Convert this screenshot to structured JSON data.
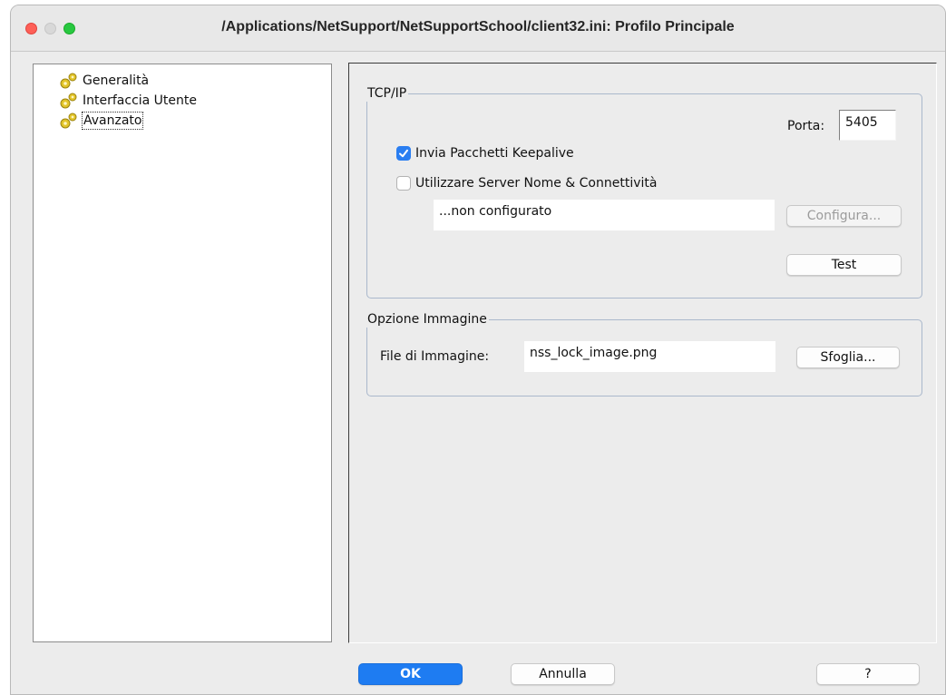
{
  "window": {
    "title": "/Applications/NetSupport/NetSupportSchool/client32.ini: Profilo Principale"
  },
  "tree": {
    "items": [
      {
        "label": "Generalità",
        "icon": "gear-icon"
      },
      {
        "label": "Interfaccia Utente",
        "icon": "gear-icon"
      },
      {
        "label": "Avanzato",
        "icon": "gear-icon",
        "selected": true
      }
    ]
  },
  "tcpip": {
    "legend": "TCP/IP",
    "porta_label": "Porta:",
    "porta_value": "5405",
    "keepalive_label": "Invia Pacchetti Keepalive",
    "keepalive_checked": true,
    "server_label": "Utilizzare Server Nome & Connettività",
    "server_checked": false,
    "server_status": "...non configurato",
    "configura_button": "Configura...",
    "test_button": "Test"
  },
  "image": {
    "legend": "Opzione Immagine",
    "file_label": "File di Immagine:",
    "file_value": "nss_lock_image.png",
    "browse_button": "Sfoglia..."
  },
  "footer": {
    "ok": "OK",
    "cancel": "Annulla",
    "help": "?"
  },
  "colors": {
    "accent": "#1e7cf2",
    "icon_yellow": "#e2c42a"
  }
}
